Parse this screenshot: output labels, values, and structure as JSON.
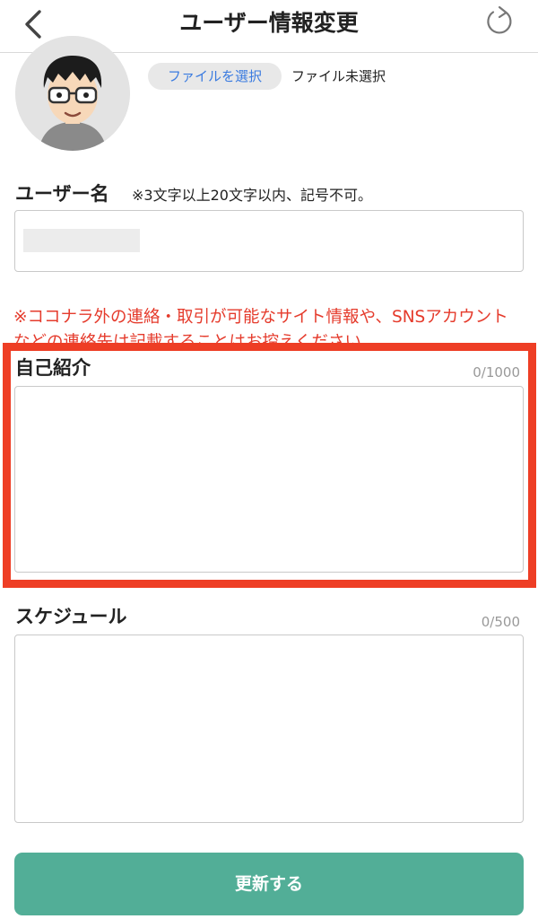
{
  "header": {
    "title": "ユーザー情報変更",
    "back_icon": "chevron-left-icon",
    "refresh_icon": "refresh-icon"
  },
  "avatar": {
    "file_button_label": "ファイルを選択",
    "file_status": "ファイル未選択"
  },
  "username": {
    "label": "ユーザー名",
    "hint": "※3文字以上20文字以内、記号不可。"
  },
  "warning_text": "※ココナラ外の連絡・取引が可能なサイト情報や、SNSアカウントなどの連絡先は記載することはお控えください。",
  "bio": {
    "label": "自己紹介",
    "counter": "0/1000"
  },
  "schedule": {
    "label": "スケジュール",
    "counter": "0/500"
  },
  "submit_label": "更新する",
  "colors": {
    "accent": "#52ae97",
    "warning": "#e53b2c",
    "highlight": "#ee3e25",
    "link": "#3a7be0"
  }
}
